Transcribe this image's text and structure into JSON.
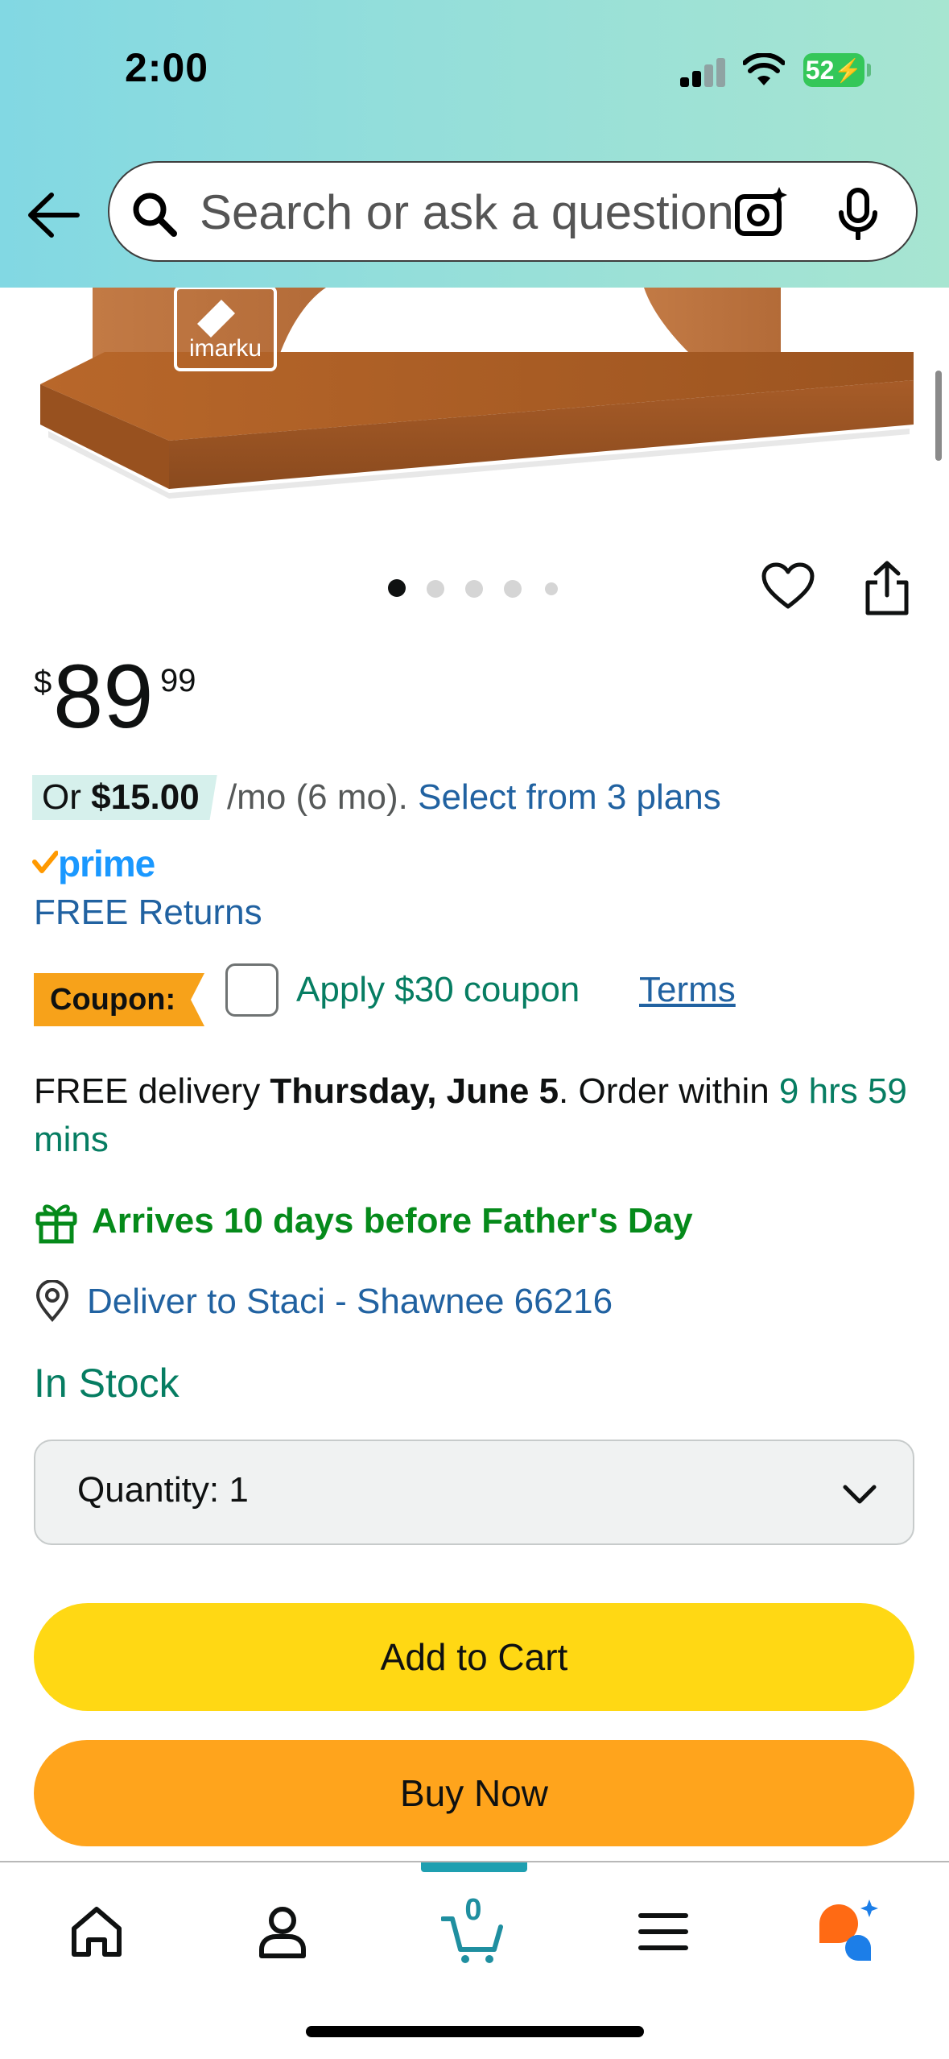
{
  "status_bar": {
    "time": "2:00",
    "battery": "52"
  },
  "search": {
    "placeholder": "Search or ask a question"
  },
  "product": {
    "brand_mark": "imarku",
    "image_count": 5,
    "current_image": 1
  },
  "price": {
    "symbol": "$",
    "whole": "89",
    "fraction": "99"
  },
  "installment": {
    "prefix": "Or",
    "amount": "$15.00",
    "term": "/mo (6 mo).",
    "link": "Select from 3 plans"
  },
  "prime_label": "prime",
  "free_returns": "FREE Returns",
  "coupon": {
    "badge": "Coupon:",
    "apply_label": "Apply $30 coupon",
    "terms": "Terms",
    "checked": false
  },
  "delivery": {
    "prefix": "FREE delivery",
    "date": "Thursday, June 5",
    "order_within": ". Order within",
    "countdown": "9 hrs 59 mins"
  },
  "fathers_day": "Arrives 10 days before Father's Day",
  "deliver_to": "Deliver to Staci - Shawnee 66216",
  "stock_status": "In Stock",
  "quantity": {
    "label": "Quantity:",
    "value": "1"
  },
  "buttons": {
    "add_to_cart": "Add to Cart",
    "buy_now": "Buy Now"
  },
  "bottom_nav": {
    "cart_count": "0",
    "active_tab": "cart",
    "items": [
      "home-icon",
      "account-icon",
      "cart-icon",
      "menu-icon",
      "rufus-icon"
    ]
  },
  "colors": {
    "header_gradient": [
      "#82d8e3",
      "#a7e5d1"
    ],
    "add_to_cart": "#ffd814",
    "buy_now": "#ffa41c",
    "link": "#2162a1",
    "green": "#067d62",
    "prime_blue": "#1a98ff"
  }
}
